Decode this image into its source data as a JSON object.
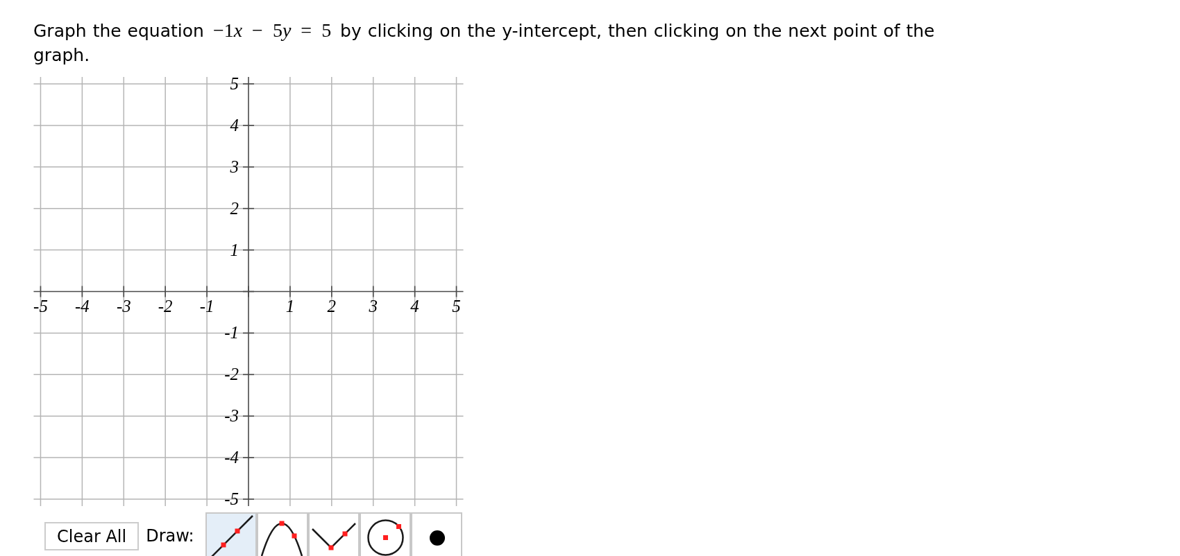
{
  "question": {
    "text": "Graph the equation",
    "equation": [
      {
        "kind": "number",
        "text": "−1"
      },
      {
        "kind": "variable",
        "text": "x"
      },
      {
        "kind": "operator",
        "text": "−"
      },
      {
        "kind": "number",
        "text": "5"
      },
      {
        "kind": "variable",
        "text": "y"
      },
      {
        "kind": "relation",
        "text": "="
      },
      {
        "kind": "number",
        "text": "5"
      }
    ],
    "text_after": "by clicking on the y-intercept, then clicking on the next point of the graph."
  },
  "graph": {
    "x_labels": [
      "-5",
      "-4",
      "-3",
      "-2",
      "-1",
      "1",
      "2",
      "3",
      "4",
      "5"
    ],
    "y_labels": [
      "5",
      "4",
      "3",
      "2",
      "1",
      "-1",
      "-2",
      "-3",
      "-4",
      "-5"
    ]
  },
  "toolbar": {
    "clear_button": "Clear All",
    "draw_label": "Draw:",
    "draw_tools": [
      {
        "kind": "line",
        "selected": true
      },
      {
        "kind": "parabola",
        "selected": false
      },
      {
        "kind": "absolute-value",
        "selected": false
      },
      {
        "kind": "circle",
        "selected": false
      },
      {
        "kind": "point",
        "selected": false
      }
    ]
  }
}
